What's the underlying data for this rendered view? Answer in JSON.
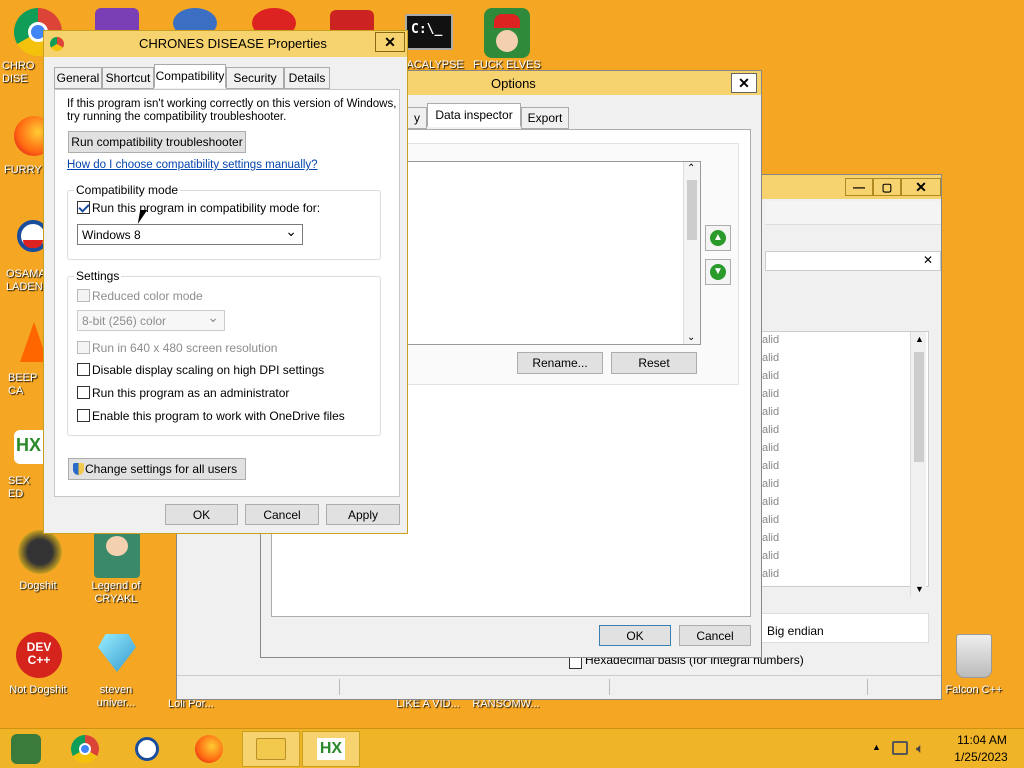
{
  "desktop": {
    "icons": [
      {
        "label": "CHRO DISE"
      },
      {
        "label": "FURRY"
      },
      {
        "label": "OSAMA LADEN"
      },
      {
        "label": "BEEP CA"
      },
      {
        "label": "SEX ED"
      },
      {
        "label": "Dogshit"
      },
      {
        "label": "Legend of CRYAKL"
      },
      {
        "label": "Not Dogshit"
      },
      {
        "label": "steven univer..."
      },
      {
        "label": "PACALYPSE"
      },
      {
        "label": "FUCK ELVES"
      },
      {
        "label": "Falcon C++"
      },
      {
        "label": "LIKE A VID..."
      },
      {
        "label": "RANSOMW..."
      },
      {
        "label": "Loli Por..."
      }
    ],
    "cmd_icon_text": "C:\\_",
    "hxd_icon_text": "HX",
    "devcpp_text": "DEV C++"
  },
  "props": {
    "title": "CHRONES DISEASE Properties",
    "tabs": [
      "General",
      "Shortcut",
      "Compatibility",
      "Security",
      "Details"
    ],
    "intro_line1": "If this program isn't working correctly on this version of Windows,",
    "intro_line2": "try running the compatibility troubleshooter.",
    "troubleshooter_btn": "Run compatibility troubleshooter",
    "manual_link": "How do I choose compatibility settings manually?",
    "compat_group": "Compatibility mode",
    "compat_check_label": "Run this program in compatibility mode for:",
    "compat_value": "Windows 8",
    "settings_group": "Settings",
    "reduced_color": "Reduced color mode",
    "color_value": "8-bit (256) color",
    "run640": "Run in 640 x 480 screen resolution",
    "dpi": "Disable display scaling on high DPI settings",
    "admin": "Run this program as an administrator",
    "onedrive": "Enable this program to work with OneDrive files",
    "change_all": "Change settings for all users",
    "ok": "OK",
    "cancel": "Cancel",
    "apply": "Apply"
  },
  "options": {
    "title": "Options",
    "tab_partial": "y",
    "tab_data_inspector": "Data inspector",
    "tab_export": "Export",
    "rename": "Rename...",
    "reset": "Reset",
    "ok": "OK",
    "cancel": "Cancel"
  },
  "hxd": {
    "rows": [
      "alid",
      "alid",
      "alid",
      "alid",
      "alid",
      "alid",
      "alid",
      "alid",
      "alid",
      "alid",
      "alid",
      "alid",
      "alid",
      "alid"
    ],
    "big_endian": "Big endian",
    "hex_basis": "Hexadecimal basis (for integral numbers)"
  },
  "taskbar": {
    "time": "11:04 AM",
    "date": "1/25/2023"
  }
}
